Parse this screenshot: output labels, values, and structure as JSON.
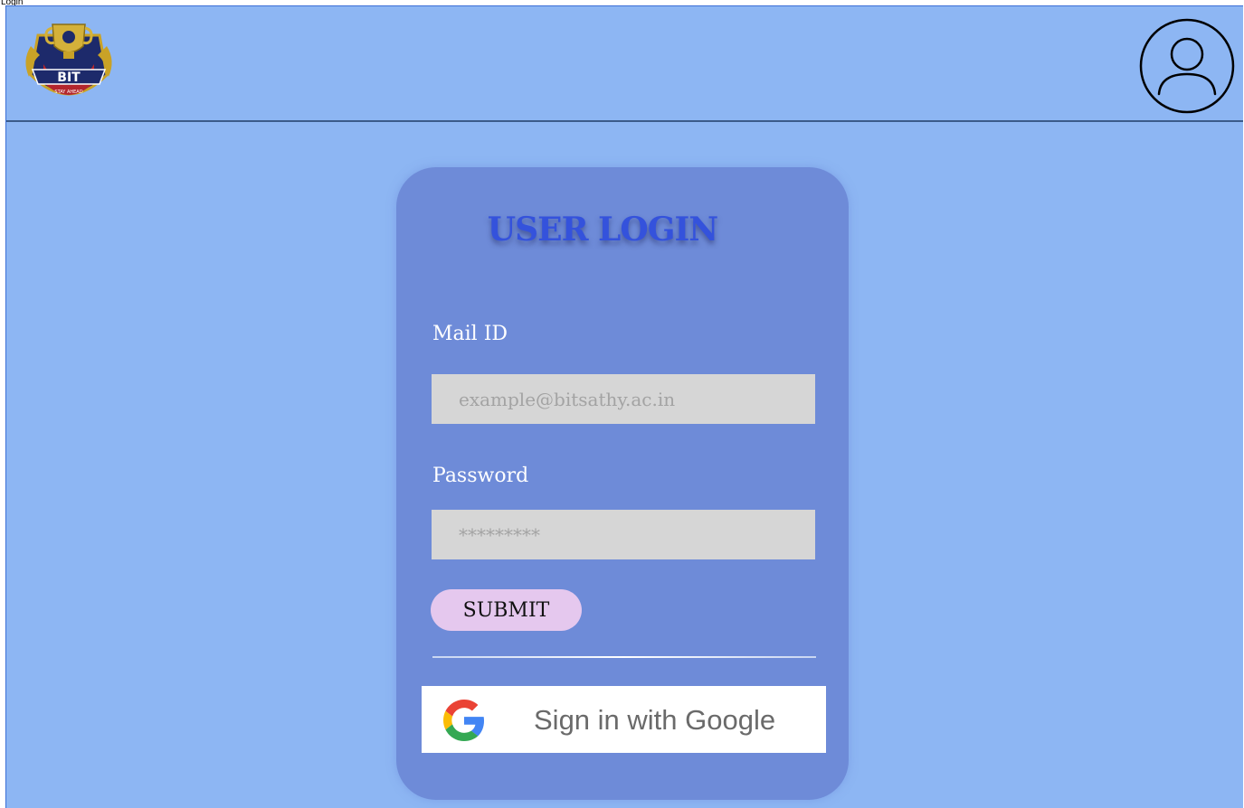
{
  "window": {
    "caption": "Login"
  },
  "header": {
    "logo": {
      "text": "BIT",
      "tagline": "STAY AHEAD"
    },
    "profile_icon": "user-circle-icon"
  },
  "login_card": {
    "title": "USER LOGIN",
    "mail": {
      "label": "Mail ID",
      "placeholder": "example@bitsathy.ac.in",
      "value": ""
    },
    "password": {
      "label": "Password",
      "placeholder": "*********",
      "value": ""
    },
    "submit_label": "SUBMIT",
    "google": {
      "label": "Sign in with Google",
      "icon": "google-g-icon"
    }
  },
  "colors": {
    "background": "#8db6f3",
    "card": "#6e8bd8",
    "title": "#3452dc",
    "input": "#d6d6d6",
    "submit": "#e5c8ee"
  }
}
